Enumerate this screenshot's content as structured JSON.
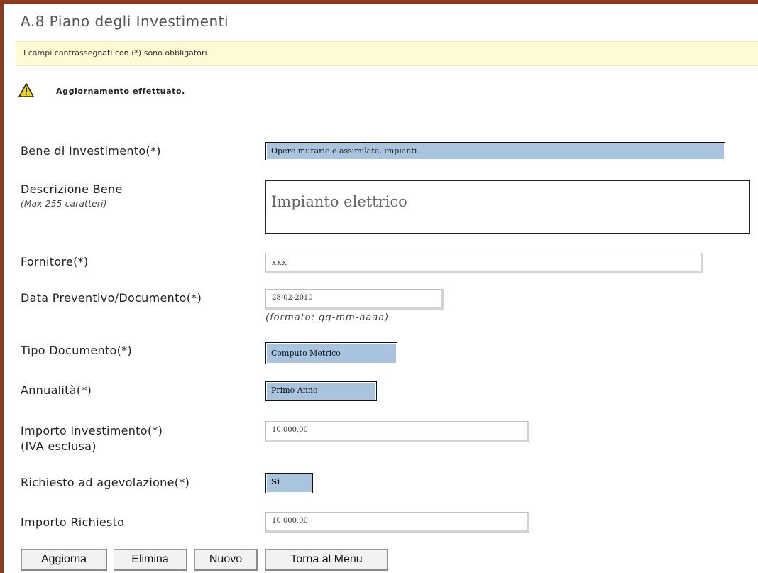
{
  "page": {
    "title": "A.8 Piano degli Investimenti",
    "required_notice": "I campi contrassegnati con (*) sono obbligatori",
    "status_message": "Aggiornamento effettuato."
  },
  "form": {
    "bene": {
      "label": "Bene di Investimento(*)",
      "value": "Opere murarie e assimilate, impianti"
    },
    "descrizione": {
      "label": "Descrizione Bene",
      "hint": "(Max 255 caratteri)",
      "value": "Impianto elettrico"
    },
    "fornitore": {
      "label": "Fornitore(*)",
      "value": "xxx"
    },
    "data_preventivo": {
      "label": "Data Preventivo/Documento(*)",
      "value": "28-02-2010",
      "hint": "(formato: gg-mm-aaaa)"
    },
    "tipo_documento": {
      "label": "Tipo Documento(*)",
      "value": "Computo Metrico"
    },
    "annualita": {
      "label": "Annualità(*)",
      "value": "Primo Anno"
    },
    "importo_investimento": {
      "label": "Importo Investimento(*)",
      "sublabel": "(IVA esclusa)",
      "value": "10.000,00"
    },
    "richiesto_agevolazione": {
      "label": "Richiesto ad agevolazione(*)",
      "value": "Si"
    },
    "importo_richiesto": {
      "label": "Importo Richiesto",
      "value": "10.000,00"
    }
  },
  "buttons": {
    "aggiorna": "Aggiorna",
    "elimina": "Elimina",
    "nuovo": "Nuovo",
    "torna": "Torna al Menu"
  },
  "icons": {
    "status": "warning-icon"
  },
  "colors": {
    "frame": "#8b3a1e",
    "notice_bg": "#fdfbd3",
    "select_bg": "#a9c4de",
    "warning": "#f2d600"
  }
}
